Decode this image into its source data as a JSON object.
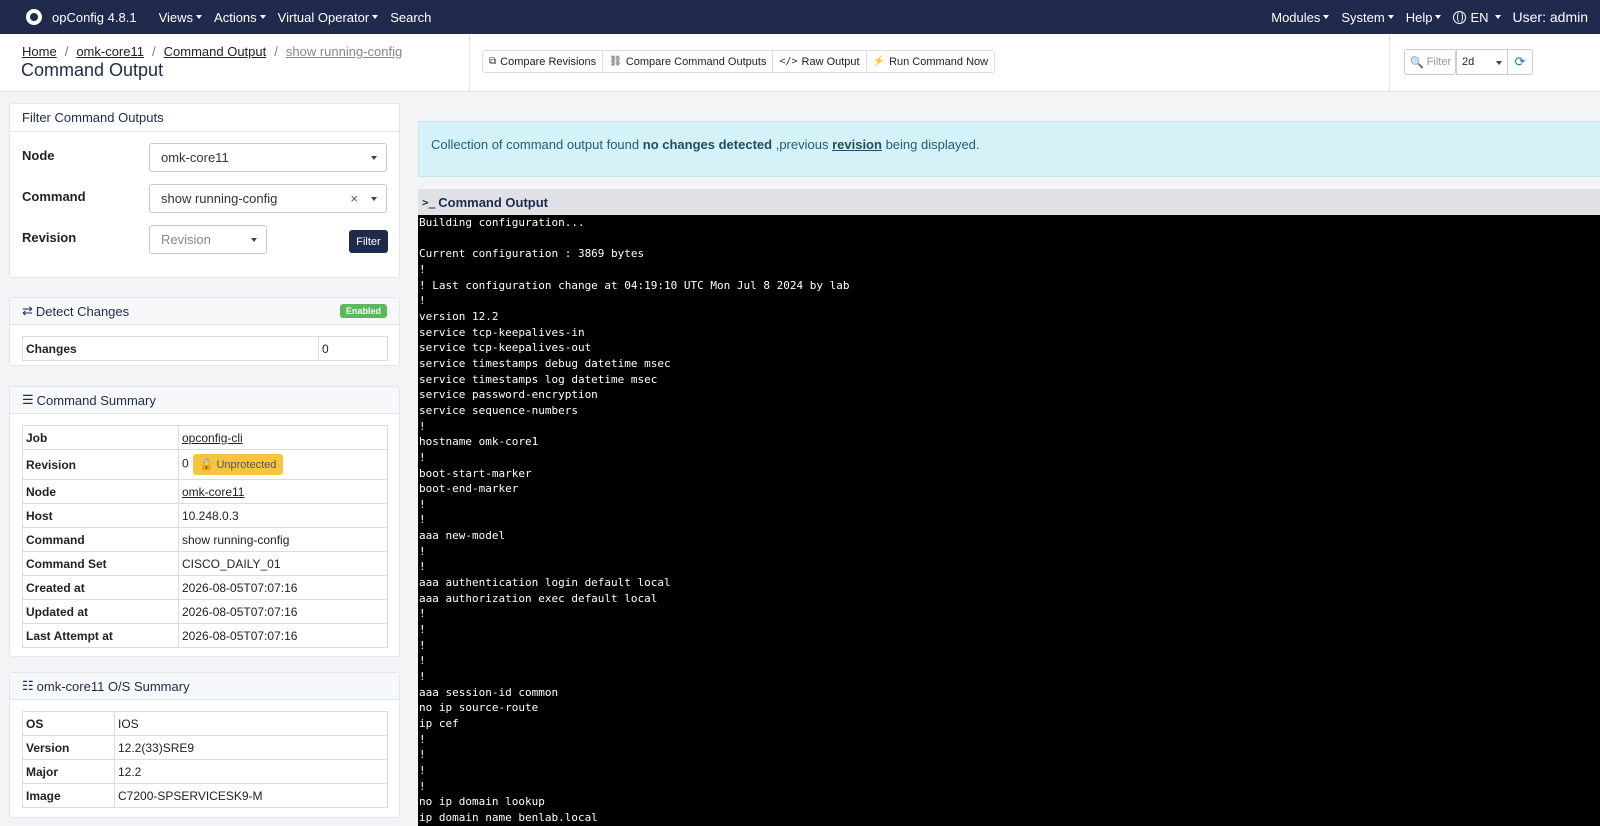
{
  "navbar": {
    "brand": "opConfig 4.8.1",
    "menu": [
      "Views",
      "Actions",
      "Virtual Operator"
    ],
    "search": "Search",
    "right_menu": [
      "Modules",
      "System",
      "Help"
    ],
    "language": "EN",
    "user": "User: admin"
  },
  "header": {
    "breadcrumb": [
      "Home",
      "omk-core11",
      "Command Output",
      "show running-config"
    ],
    "title": "Command Output",
    "toolbar": [
      {
        "icon": "compare-revisions-icon",
        "label": "Compare Revisions"
      },
      {
        "icon": "compare-outputs-icon",
        "label": "Compare Command Outputs"
      },
      {
        "icon": "code-icon",
        "label": "Raw Output"
      },
      {
        "icon": "bolt-icon",
        "label": "Run Command Now"
      }
    ],
    "filter_placeholder": "Filter",
    "range": "2d"
  },
  "filter_card": {
    "title": "Filter Command Outputs",
    "node_label": "Node",
    "node_value": "omk-core11",
    "command_label": "Command",
    "command_value": "show running-config",
    "revision_label": "Revision",
    "revision_placeholder": "Revision",
    "filter_button": "Filter"
  },
  "detect_card": {
    "title": "Detect Changes",
    "badge": "Enabled",
    "changes_label": "Changes",
    "changes_value": "0"
  },
  "summary_card": {
    "title": "Command Summary",
    "job_label": "Job",
    "job_value": "opconfig-cli",
    "revision_label": "Revision",
    "revision_value": "0",
    "revision_badge": "Unprotected",
    "node_label": "Node",
    "node_value": "omk-core11",
    "host_label": "Host",
    "host_value": "10.248.0.3",
    "command_label": "Command",
    "command_value": "show running-config",
    "command_set_label": "Command Set",
    "command_set_value": "CISCO_DAILY_01",
    "created_label": "Created at",
    "created_value": "2026-08-05T07:07:16",
    "updated_label": "Updated at",
    "updated_value": "2026-08-05T07:07:16",
    "last_attempt_label": "Last Attempt at",
    "last_attempt_value": "2026-08-05T07:07:16"
  },
  "os_card": {
    "title": "omk-core11 O/S Summary",
    "os_label": "OS",
    "os_value": "IOS",
    "version_label": "Version",
    "version_value": "12.2(33)SRE9",
    "major_label": "Major",
    "major_value": "12.2",
    "image_label": "Image",
    "image_value": "C7200-SPSERVICESK9-M"
  },
  "alert": {
    "prefix": "Collection of command output found",
    "bold": "no changes detected",
    "middle": ",previous",
    "link": "revision",
    "suffix": "being displayed."
  },
  "output": {
    "title": "Command Output",
    "text": "Building configuration...\n\nCurrent configuration : 3869 bytes\n!\n! Last configuration change at 04:19:10 UTC Mon Jul 8 2024 by lab\n!\nversion 12.2\nservice tcp-keepalives-in\nservice tcp-keepalives-out\nservice timestamps debug datetime msec\nservice timestamps log datetime msec\nservice password-encryption\nservice sequence-numbers\n!\nhostname omk-core1\n!\nboot-start-marker\nboot-end-marker\n!\n!\naaa new-model\n!\n!\naaa authentication login default local\naaa authorization exec default local\n!\n!\n!\n!\n!\naaa session-id common\nno ip source-route\nip cef\n!\n!\n!\n!\nno ip domain lookup\nip domain name benlab.local"
  }
}
